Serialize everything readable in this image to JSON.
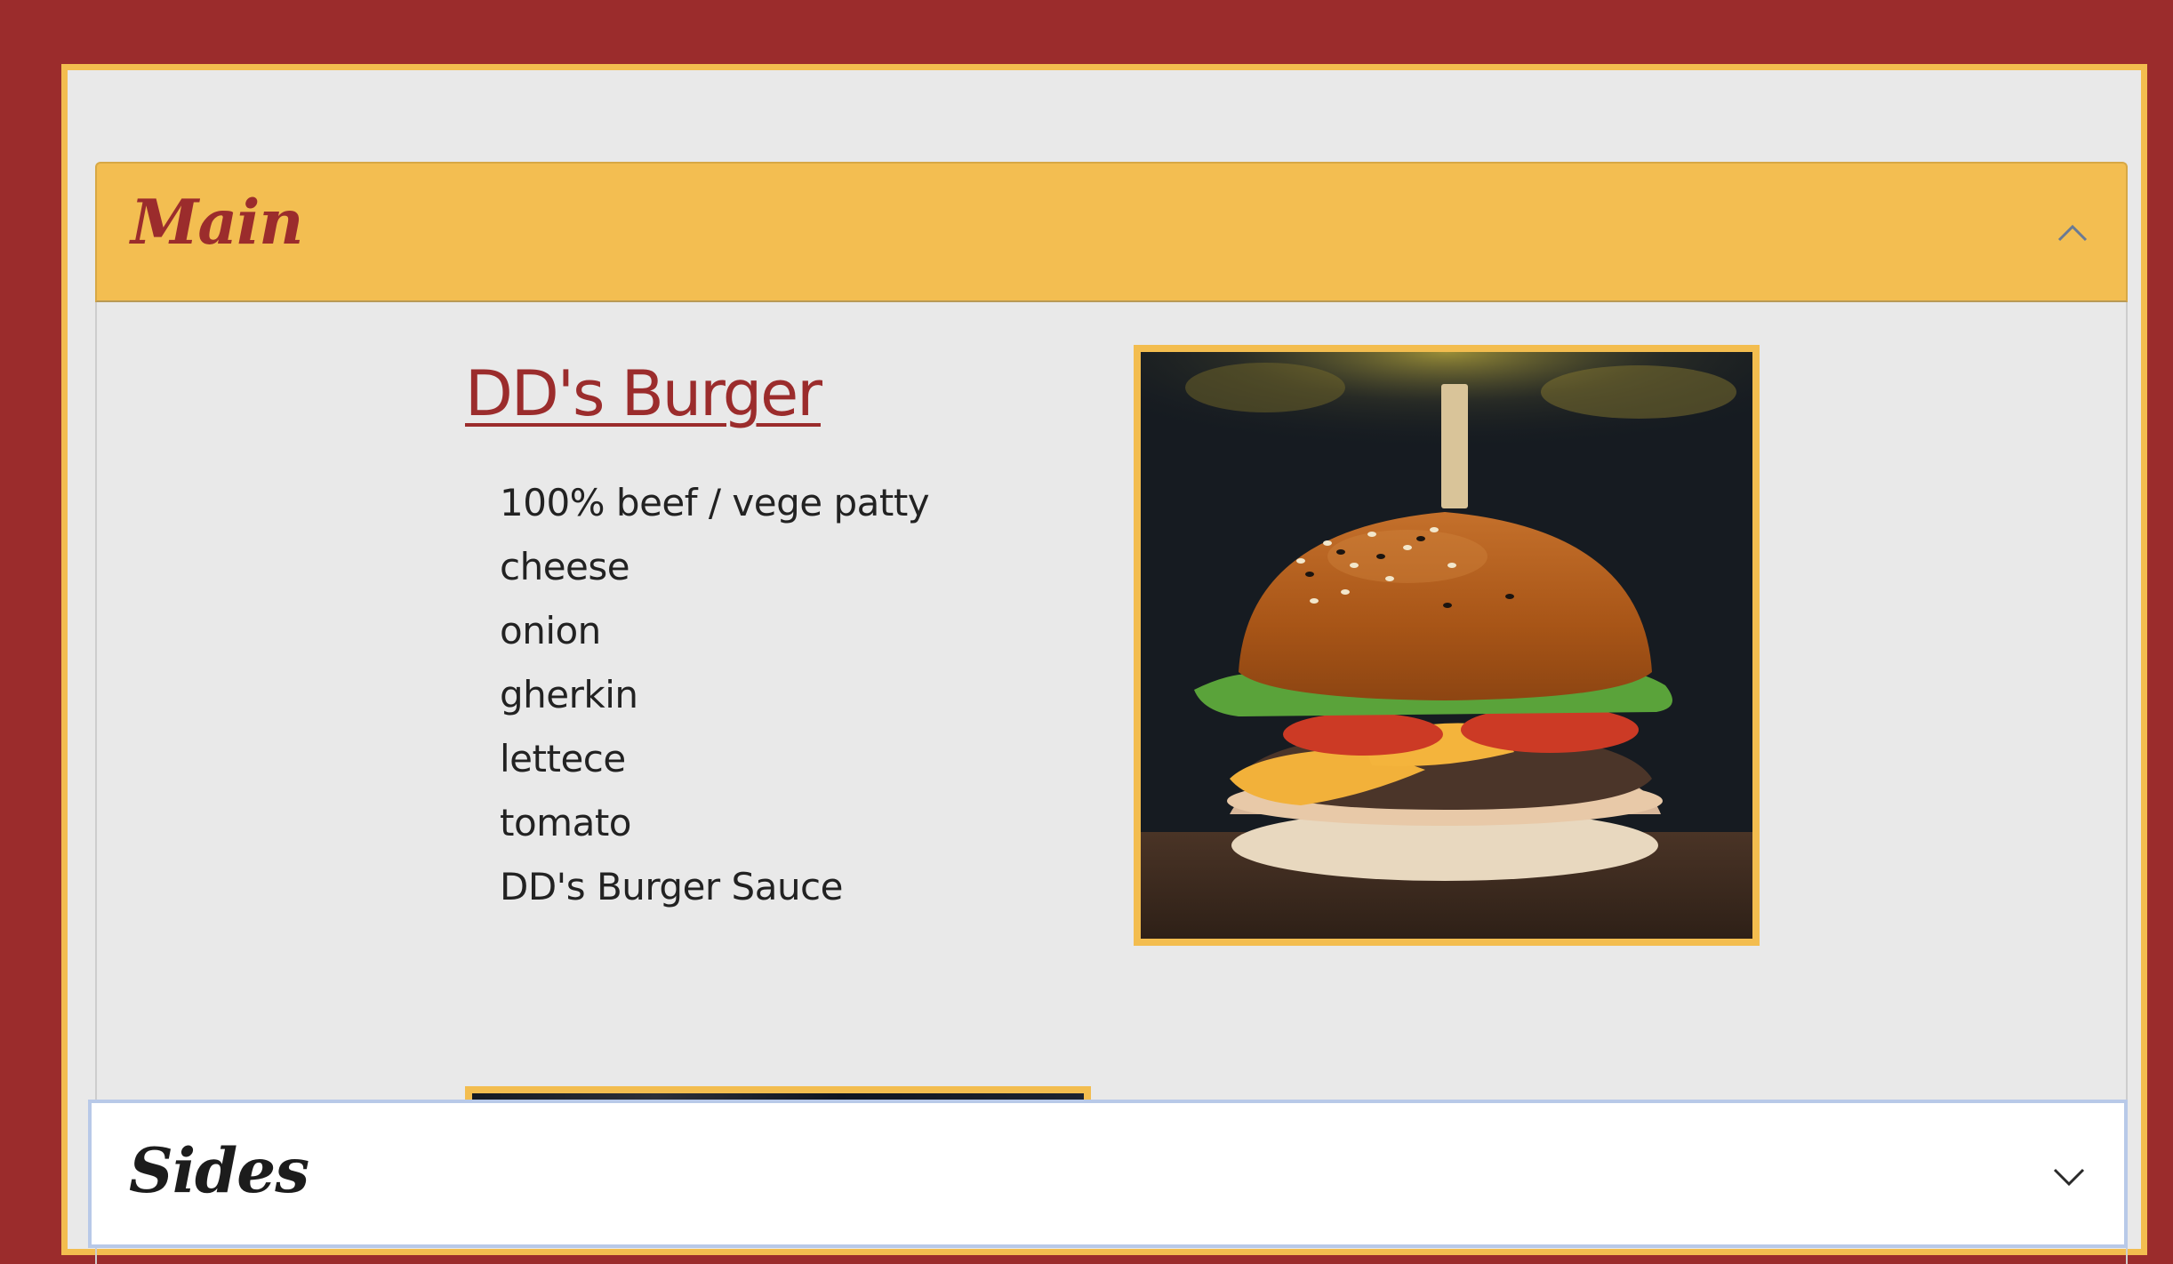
{
  "colors": {
    "background": "#9b2c2c",
    "frame_border": "#f3bd4f",
    "panel_background": "#e9e9e9",
    "header_yellow": "#f3be51",
    "brand_red": "#9b2c2c",
    "sides_focus_border": "#b8c9e8"
  },
  "accordion": {
    "main": {
      "title": "Main",
      "expanded": true,
      "toggle_icon": "chevron-up-icon",
      "item": {
        "name": "DD's Burger",
        "ingredients": [
          "100% beef / vege patty",
          "cheese",
          "onion",
          "gherkin",
          "lettece",
          "tomato",
          "DD's Burger Sauce"
        ],
        "photo": "burger-photo"
      }
    },
    "sides": {
      "title": "Sides",
      "expanded": false,
      "toggle_icon": "chevron-down-icon"
    }
  }
}
